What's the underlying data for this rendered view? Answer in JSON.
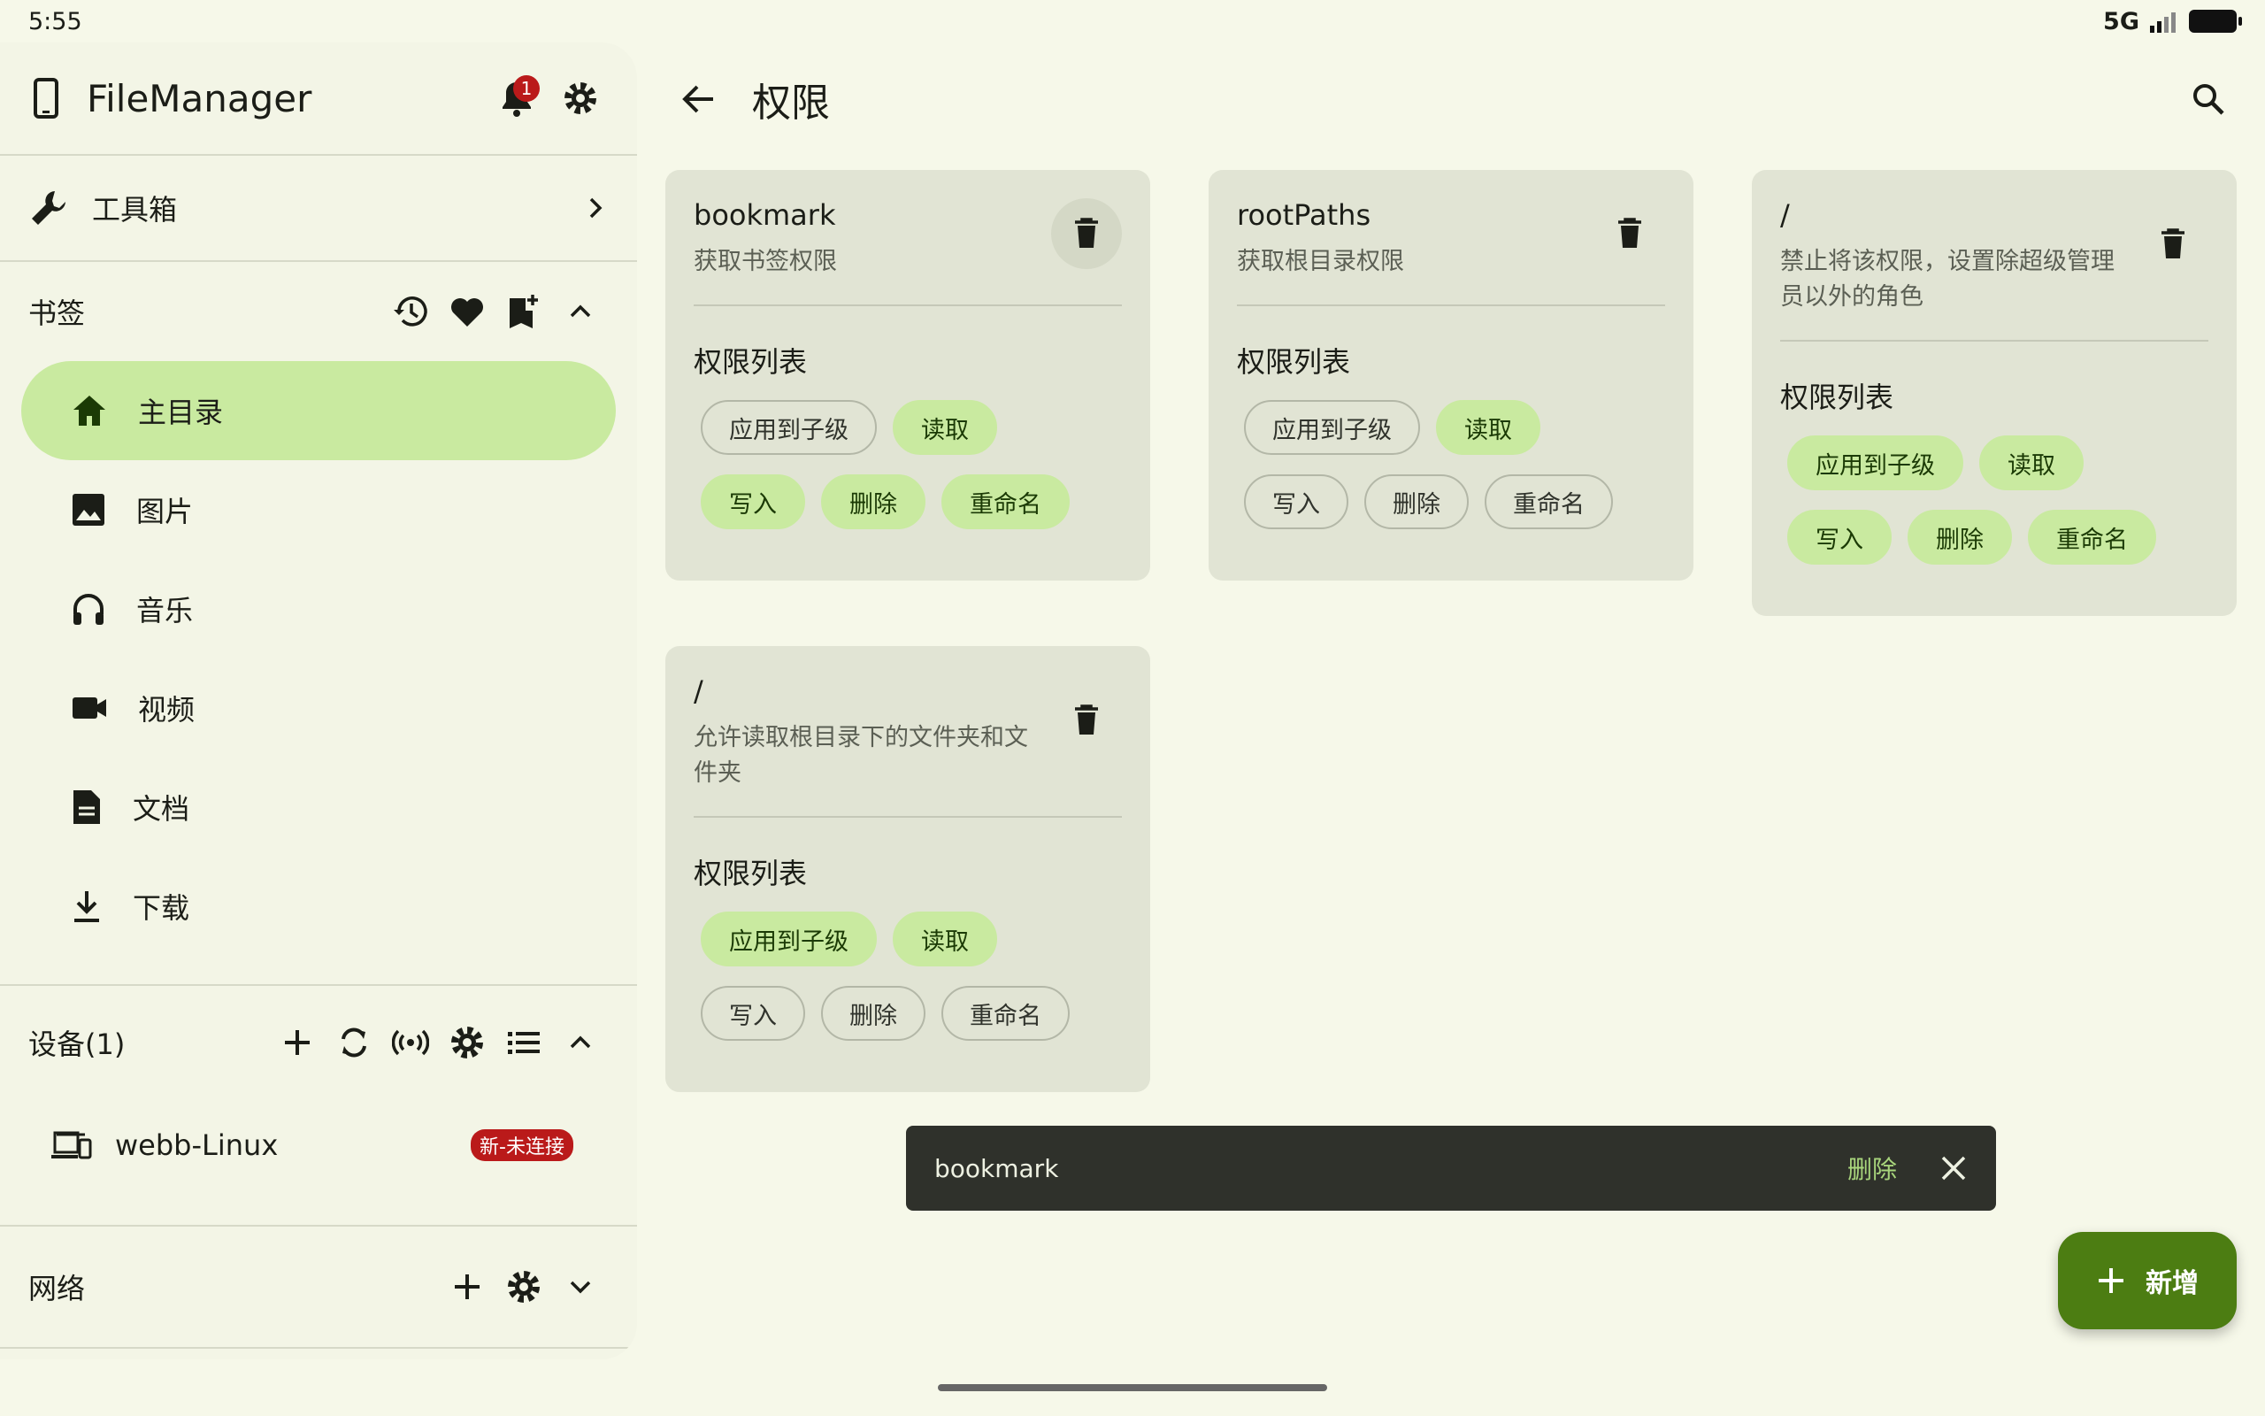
{
  "status": {
    "time": "5:55",
    "network": "5G"
  },
  "drawer": {
    "app_title": "FileManager",
    "notification_count": "1",
    "toolbox_label": "工具箱",
    "bookmarks_title": "书签",
    "nav_items": [
      {
        "label": "主目录",
        "icon": "home-icon",
        "active": true
      },
      {
        "label": "图片",
        "icon": "image-icon"
      },
      {
        "label": "音乐",
        "icon": "headphones-icon"
      },
      {
        "label": "视频",
        "icon": "video-icon"
      },
      {
        "label": "文档",
        "icon": "document-icon"
      },
      {
        "label": "下载",
        "icon": "download-icon"
      }
    ],
    "devices_title": "设备(1)",
    "device": {
      "name": "webb-Linux",
      "badge": "新-未连接"
    },
    "network_title": "网络"
  },
  "main": {
    "title": "权限"
  },
  "cards": [
    {
      "name": "bookmark",
      "desc": "获取书签权限",
      "perm_title": "权限列表",
      "chips": [
        {
          "label": "应用到子级",
          "on": false
        },
        {
          "label": "读取",
          "on": true
        },
        {
          "label": "写入",
          "on": true
        },
        {
          "label": "删除",
          "on": true
        },
        {
          "label": "重命名",
          "on": true
        }
      ]
    },
    {
      "name": "rootPaths",
      "desc": "获取根目录权限",
      "perm_title": "权限列表",
      "chips": [
        {
          "label": "应用到子级",
          "on": false
        },
        {
          "label": "读取",
          "on": true
        },
        {
          "label": "写入",
          "on": false
        },
        {
          "label": "删除",
          "on": false
        },
        {
          "label": "重命名",
          "on": false
        }
      ]
    },
    {
      "name": "/",
      "desc": "禁止将该权限，设置除超级管理员以外的角色",
      "perm_title": "权限列表",
      "chips": [
        {
          "label": "应用到子级",
          "on": true
        },
        {
          "label": "读取",
          "on": true
        },
        {
          "label": "写入",
          "on": true
        },
        {
          "label": "删除",
          "on": true
        },
        {
          "label": "重命名",
          "on": true
        }
      ]
    },
    {
      "name": "/",
      "desc": "允许读取根目录下的文件夹和文件夹",
      "perm_title": "权限列表",
      "chips": [
        {
          "label": "应用到子级",
          "on": true
        },
        {
          "label": "读取",
          "on": true
        },
        {
          "label": "写入",
          "on": false
        },
        {
          "label": "删除",
          "on": false
        },
        {
          "label": "重命名",
          "on": false
        }
      ]
    }
  ],
  "snackbar": {
    "text": "bookmark",
    "action": "删除"
  },
  "fab": {
    "label": "新增"
  }
}
